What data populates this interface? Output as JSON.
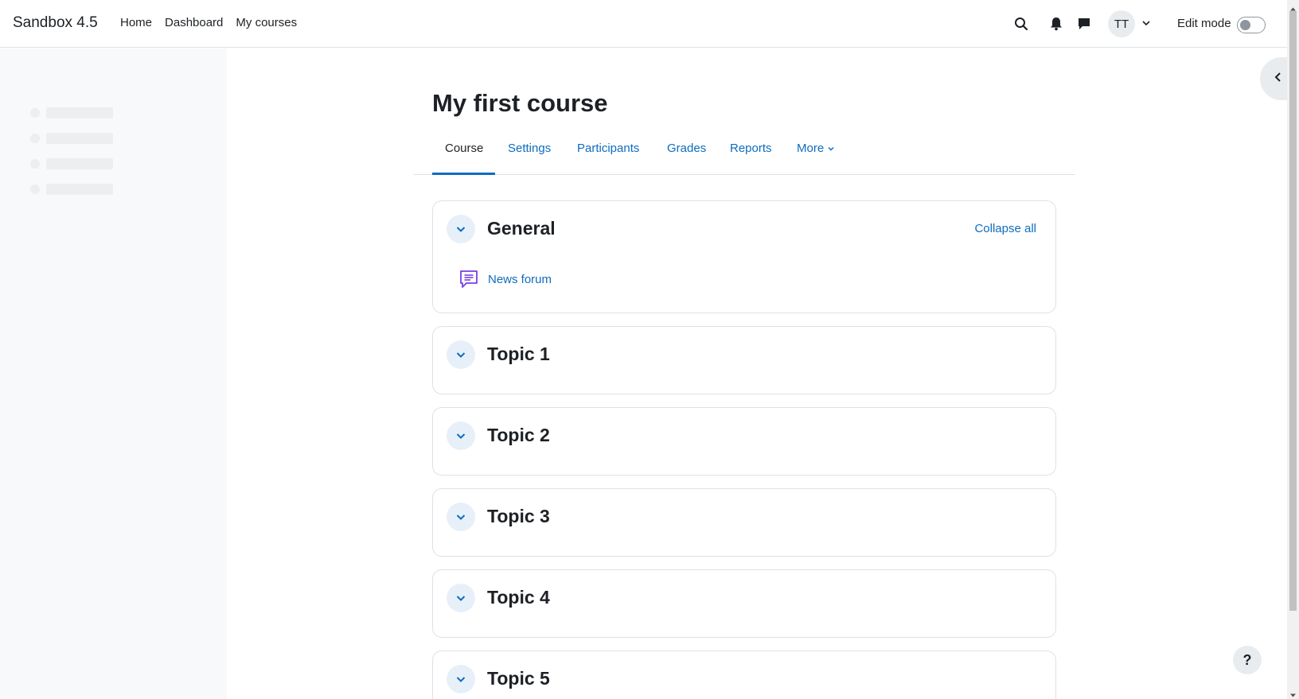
{
  "navbar": {
    "brand": "Sandbox 4.5",
    "links": [
      "Home",
      "Dashboard",
      "My courses"
    ],
    "icons": [
      "search-icon",
      "bell-icon",
      "chat-icon"
    ],
    "avatar_initials": "TT",
    "edit_mode_label": "Edit mode",
    "edit_mode_on": false
  },
  "page": {
    "title": "My first course"
  },
  "secondary_nav": {
    "tabs": [
      "Course",
      "Settings",
      "Participants",
      "Grades",
      "Reports",
      "More"
    ],
    "active": "Course"
  },
  "sections": [
    {
      "title": "General",
      "collapse_all_label": "Collapse all",
      "activities": [
        {
          "name": "News forum",
          "icon": "forum-icon"
        }
      ]
    },
    {
      "title": "Topic 1"
    },
    {
      "title": "Topic 2"
    },
    {
      "title": "Topic 3"
    },
    {
      "title": "Topic 4"
    },
    {
      "title": "Topic 5"
    }
  ],
  "help": {
    "label": "?"
  },
  "colors": {
    "link": "#0f6cbf",
    "text": "#1d2125",
    "forum_icon": "#7b3fe4"
  }
}
